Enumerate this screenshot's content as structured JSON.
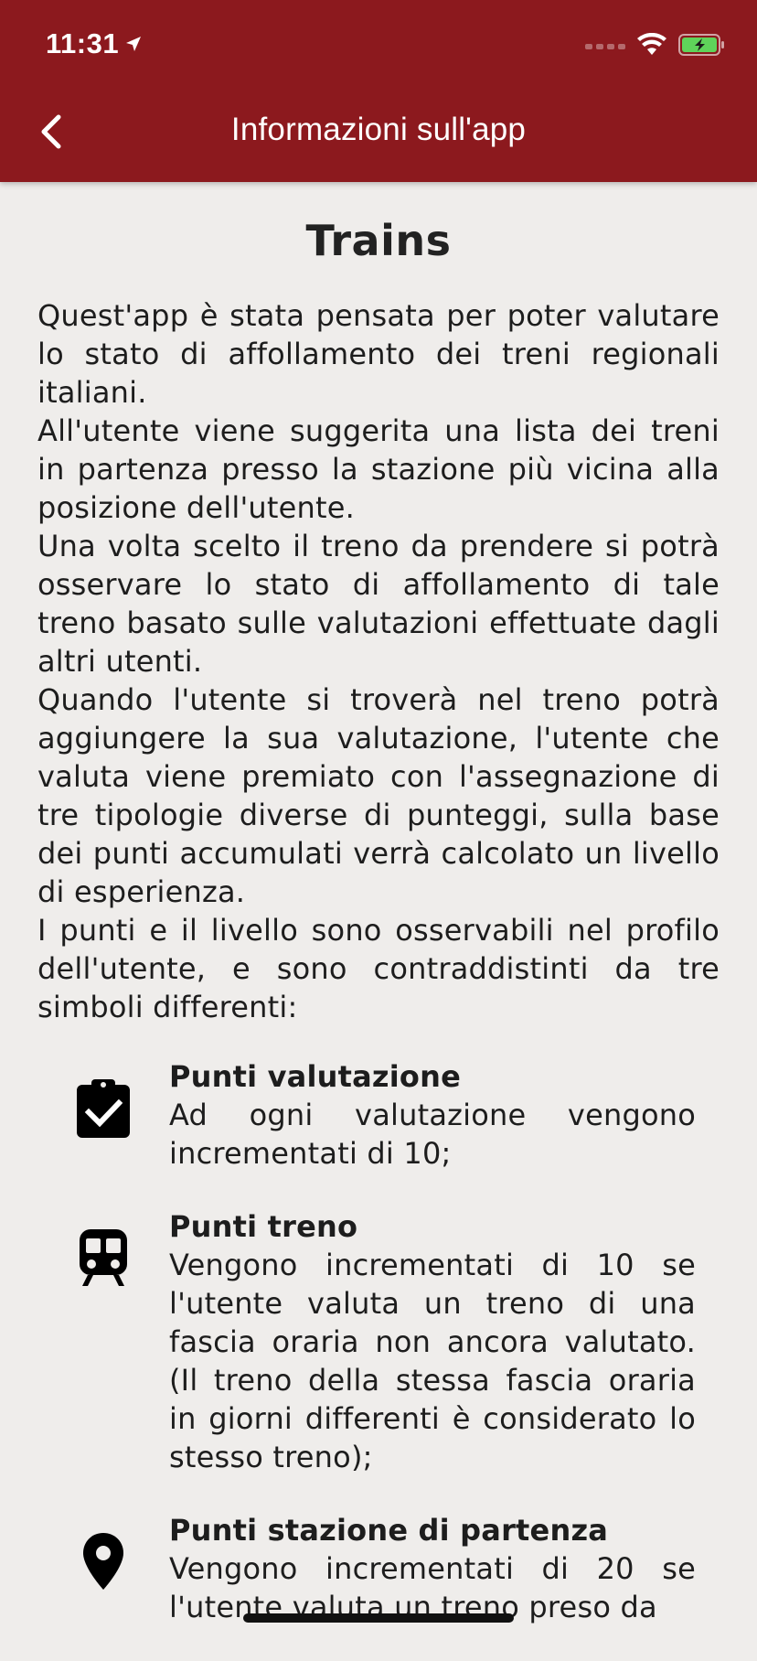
{
  "status_bar": {
    "time": "11:31"
  },
  "nav": {
    "title": "Informazioni sull'app"
  },
  "app_title": "Trains",
  "intro_paragraphs": [
    "Quest'app è stata pensata per poter valutare lo stato di affollamento dei treni regionali italiani.",
    "All'utente viene suggerita una lista dei treni in partenza presso la stazione più vicina alla posizione dell'utente.",
    "Una volta scelto il treno da prendere si potrà osservare lo stato di affollamento di tale treno basato sulle valutazioni effettuate dagli altri utenti.",
    "Quando l'utente si troverà nel treno potrà aggiungere la sua valutazione, l'utente che valuta viene premiato con l'assegnazione di tre tipologie diverse di punteggi, sulla base dei punti accumulati verrà calcolato un livello di esperienza.",
    "I punti e il livello sono osservabili nel profilo dell'utente, e sono contraddistinti da tre simboli differenti:"
  ],
  "points": [
    {
      "icon": "clipboard-check-icon",
      "title": "Punti valutazione",
      "description": "Ad ogni valutazione vengono incrementati di 10;"
    },
    {
      "icon": "train-icon",
      "title": "Punti treno",
      "description": "Vengono incrementati di 10 se l'utente valuta un treno di una fascia oraria non ancora valutato. (Il treno della stessa fascia oraria in giorni differenti è considerato lo stesso treno);"
    },
    {
      "icon": "map-pin-icon",
      "title": "Punti stazione di partenza",
      "description": "Vengono incrementati di 20 se l'utente valuta un treno preso da"
    }
  ],
  "colors": {
    "header": "#8c191e",
    "background": "#efedeb",
    "battery": "#5fd35a"
  }
}
